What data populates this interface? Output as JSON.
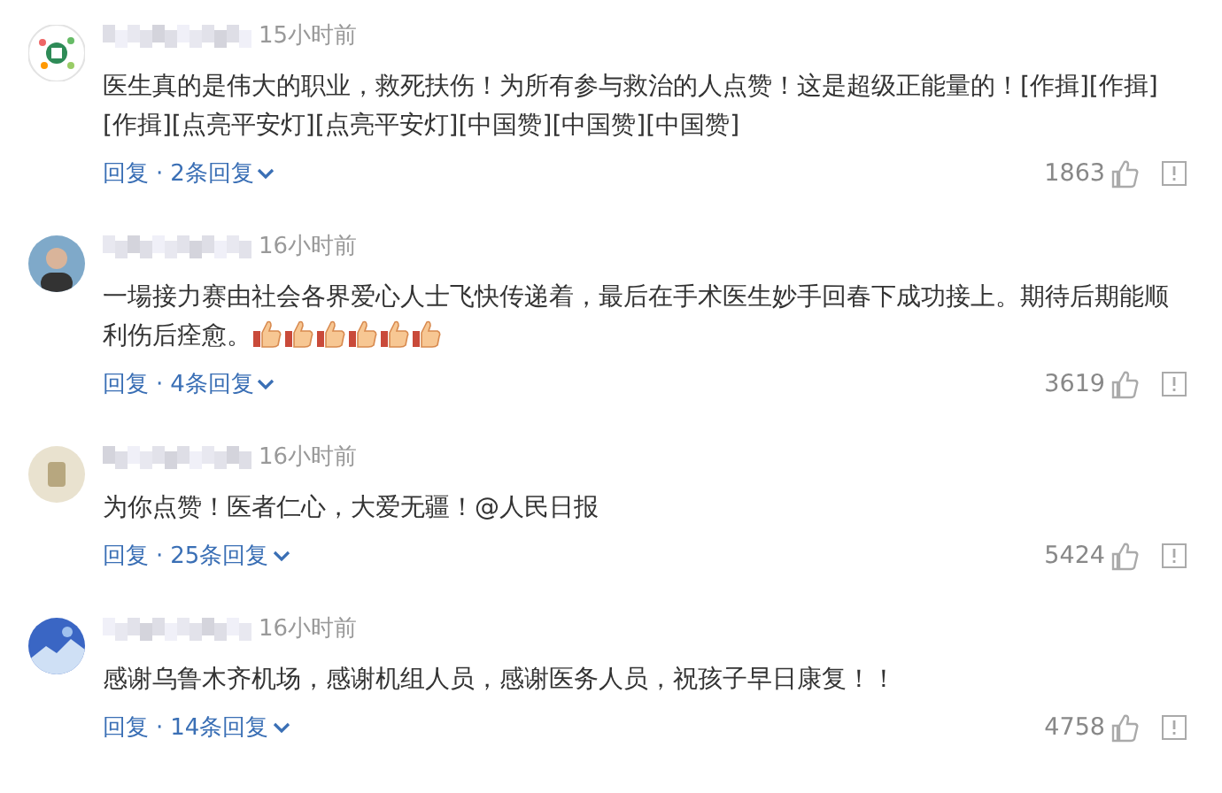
{
  "comments": [
    {
      "avatar": {
        "kind": "logo"
      },
      "name_redacted": true,
      "time": "15小时前",
      "text": "医生真的是伟大的职业，救死扶伤！为所有参与救治的人点赞！这是超级正能量的！[作揖][作揖][作揖][点亮平安灯][点亮平安灯][中国赞][中国赞][中国赞]",
      "reply": "回复",
      "reply_sep": "·",
      "replies": "2条回复",
      "likes": "1863"
    },
    {
      "avatar": {
        "kind": "person"
      },
      "name_redacted": true,
      "time": "16小时前",
      "text": "一場接力赛由社会各界爱心人士飞快传递着，最后在手术医生妙手回春下成功接上。期待后期能顺利伤后痊愈。",
      "emojis": [
        {
          "kind": "thumbs-up"
        },
        {
          "kind": "thumbs-up"
        },
        {
          "kind": "thumbs-up"
        },
        {
          "kind": "thumbs-up"
        },
        {
          "kind": "thumbs-up"
        },
        {
          "kind": "thumbs-up"
        }
      ],
      "reply": "回复",
      "reply_sep": "·",
      "replies": "4条回复",
      "likes": "3619"
    },
    {
      "avatar": {
        "kind": "badge"
      },
      "name_redacted": true,
      "time": "16小时前",
      "text": "为你点赞！医者仁心，大爱无疆！@人民日报",
      "reply": "回复",
      "reply_sep": "·",
      "replies": "25条回复",
      "likes": "5424"
    },
    {
      "avatar": {
        "kind": "landscape"
      },
      "name_redacted": true,
      "time": "16小时前",
      "text": "感谢乌鲁木齐机场，感谢机组人员，感谢医务人员，祝孩子早日康复！！",
      "reply": "回复",
      "reply_sep": "·",
      "replies": "14条回复",
      "likes": "4758"
    }
  ]
}
